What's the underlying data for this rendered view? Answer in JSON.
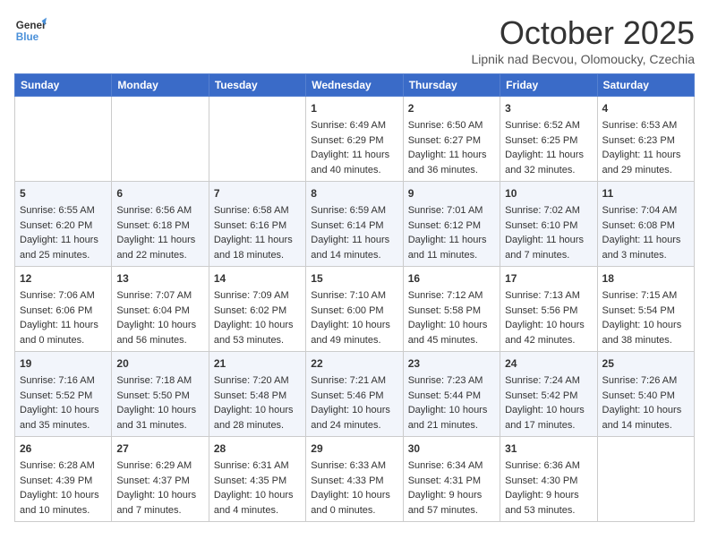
{
  "header": {
    "logo_line1": "General",
    "logo_line2": "Blue",
    "title": "October 2025",
    "subtitle": "Lipnik nad Becvou, Olomoucky, Czechia"
  },
  "days_of_week": [
    "Sunday",
    "Monday",
    "Tuesday",
    "Wednesday",
    "Thursday",
    "Friday",
    "Saturday"
  ],
  "weeks": [
    [
      {
        "day": "",
        "lines": []
      },
      {
        "day": "",
        "lines": []
      },
      {
        "day": "",
        "lines": []
      },
      {
        "day": "1",
        "lines": [
          "Sunrise: 6:49 AM",
          "Sunset: 6:29 PM",
          "Daylight: 11 hours",
          "and 40 minutes."
        ]
      },
      {
        "day": "2",
        "lines": [
          "Sunrise: 6:50 AM",
          "Sunset: 6:27 PM",
          "Daylight: 11 hours",
          "and 36 minutes."
        ]
      },
      {
        "day": "3",
        "lines": [
          "Sunrise: 6:52 AM",
          "Sunset: 6:25 PM",
          "Daylight: 11 hours",
          "and 32 minutes."
        ]
      },
      {
        "day": "4",
        "lines": [
          "Sunrise: 6:53 AM",
          "Sunset: 6:23 PM",
          "Daylight: 11 hours",
          "and 29 minutes."
        ]
      }
    ],
    [
      {
        "day": "5",
        "lines": [
          "Sunrise: 6:55 AM",
          "Sunset: 6:20 PM",
          "Daylight: 11 hours",
          "and 25 minutes."
        ]
      },
      {
        "day": "6",
        "lines": [
          "Sunrise: 6:56 AM",
          "Sunset: 6:18 PM",
          "Daylight: 11 hours",
          "and 22 minutes."
        ]
      },
      {
        "day": "7",
        "lines": [
          "Sunrise: 6:58 AM",
          "Sunset: 6:16 PM",
          "Daylight: 11 hours",
          "and 18 minutes."
        ]
      },
      {
        "day": "8",
        "lines": [
          "Sunrise: 6:59 AM",
          "Sunset: 6:14 PM",
          "Daylight: 11 hours",
          "and 14 minutes."
        ]
      },
      {
        "day": "9",
        "lines": [
          "Sunrise: 7:01 AM",
          "Sunset: 6:12 PM",
          "Daylight: 11 hours",
          "and 11 minutes."
        ]
      },
      {
        "day": "10",
        "lines": [
          "Sunrise: 7:02 AM",
          "Sunset: 6:10 PM",
          "Daylight: 11 hours",
          "and 7 minutes."
        ]
      },
      {
        "day": "11",
        "lines": [
          "Sunrise: 7:04 AM",
          "Sunset: 6:08 PM",
          "Daylight: 11 hours",
          "and 3 minutes."
        ]
      }
    ],
    [
      {
        "day": "12",
        "lines": [
          "Sunrise: 7:06 AM",
          "Sunset: 6:06 PM",
          "Daylight: 11 hours",
          "and 0 minutes."
        ]
      },
      {
        "day": "13",
        "lines": [
          "Sunrise: 7:07 AM",
          "Sunset: 6:04 PM",
          "Daylight: 10 hours",
          "and 56 minutes."
        ]
      },
      {
        "day": "14",
        "lines": [
          "Sunrise: 7:09 AM",
          "Sunset: 6:02 PM",
          "Daylight: 10 hours",
          "and 53 minutes."
        ]
      },
      {
        "day": "15",
        "lines": [
          "Sunrise: 7:10 AM",
          "Sunset: 6:00 PM",
          "Daylight: 10 hours",
          "and 49 minutes."
        ]
      },
      {
        "day": "16",
        "lines": [
          "Sunrise: 7:12 AM",
          "Sunset: 5:58 PM",
          "Daylight: 10 hours",
          "and 45 minutes."
        ]
      },
      {
        "day": "17",
        "lines": [
          "Sunrise: 7:13 AM",
          "Sunset: 5:56 PM",
          "Daylight: 10 hours",
          "and 42 minutes."
        ]
      },
      {
        "day": "18",
        "lines": [
          "Sunrise: 7:15 AM",
          "Sunset: 5:54 PM",
          "Daylight: 10 hours",
          "and 38 minutes."
        ]
      }
    ],
    [
      {
        "day": "19",
        "lines": [
          "Sunrise: 7:16 AM",
          "Sunset: 5:52 PM",
          "Daylight: 10 hours",
          "and 35 minutes."
        ]
      },
      {
        "day": "20",
        "lines": [
          "Sunrise: 7:18 AM",
          "Sunset: 5:50 PM",
          "Daylight: 10 hours",
          "and 31 minutes."
        ]
      },
      {
        "day": "21",
        "lines": [
          "Sunrise: 7:20 AM",
          "Sunset: 5:48 PM",
          "Daylight: 10 hours",
          "and 28 minutes."
        ]
      },
      {
        "day": "22",
        "lines": [
          "Sunrise: 7:21 AM",
          "Sunset: 5:46 PM",
          "Daylight: 10 hours",
          "and 24 minutes."
        ]
      },
      {
        "day": "23",
        "lines": [
          "Sunrise: 7:23 AM",
          "Sunset: 5:44 PM",
          "Daylight: 10 hours",
          "and 21 minutes."
        ]
      },
      {
        "day": "24",
        "lines": [
          "Sunrise: 7:24 AM",
          "Sunset: 5:42 PM",
          "Daylight: 10 hours",
          "and 17 minutes."
        ]
      },
      {
        "day": "25",
        "lines": [
          "Sunrise: 7:26 AM",
          "Sunset: 5:40 PM",
          "Daylight: 10 hours",
          "and 14 minutes."
        ]
      }
    ],
    [
      {
        "day": "26",
        "lines": [
          "Sunrise: 6:28 AM",
          "Sunset: 4:39 PM",
          "Daylight: 10 hours",
          "and 10 minutes."
        ]
      },
      {
        "day": "27",
        "lines": [
          "Sunrise: 6:29 AM",
          "Sunset: 4:37 PM",
          "Daylight: 10 hours",
          "and 7 minutes."
        ]
      },
      {
        "day": "28",
        "lines": [
          "Sunrise: 6:31 AM",
          "Sunset: 4:35 PM",
          "Daylight: 10 hours",
          "and 4 minutes."
        ]
      },
      {
        "day": "29",
        "lines": [
          "Sunrise: 6:33 AM",
          "Sunset: 4:33 PM",
          "Daylight: 10 hours",
          "and 0 minutes."
        ]
      },
      {
        "day": "30",
        "lines": [
          "Sunrise: 6:34 AM",
          "Sunset: 4:31 PM",
          "Daylight: 9 hours",
          "and 57 minutes."
        ]
      },
      {
        "day": "31",
        "lines": [
          "Sunrise: 6:36 AM",
          "Sunset: 4:30 PM",
          "Daylight: 9 hours",
          "and 53 minutes."
        ]
      },
      {
        "day": "",
        "lines": []
      }
    ]
  ]
}
